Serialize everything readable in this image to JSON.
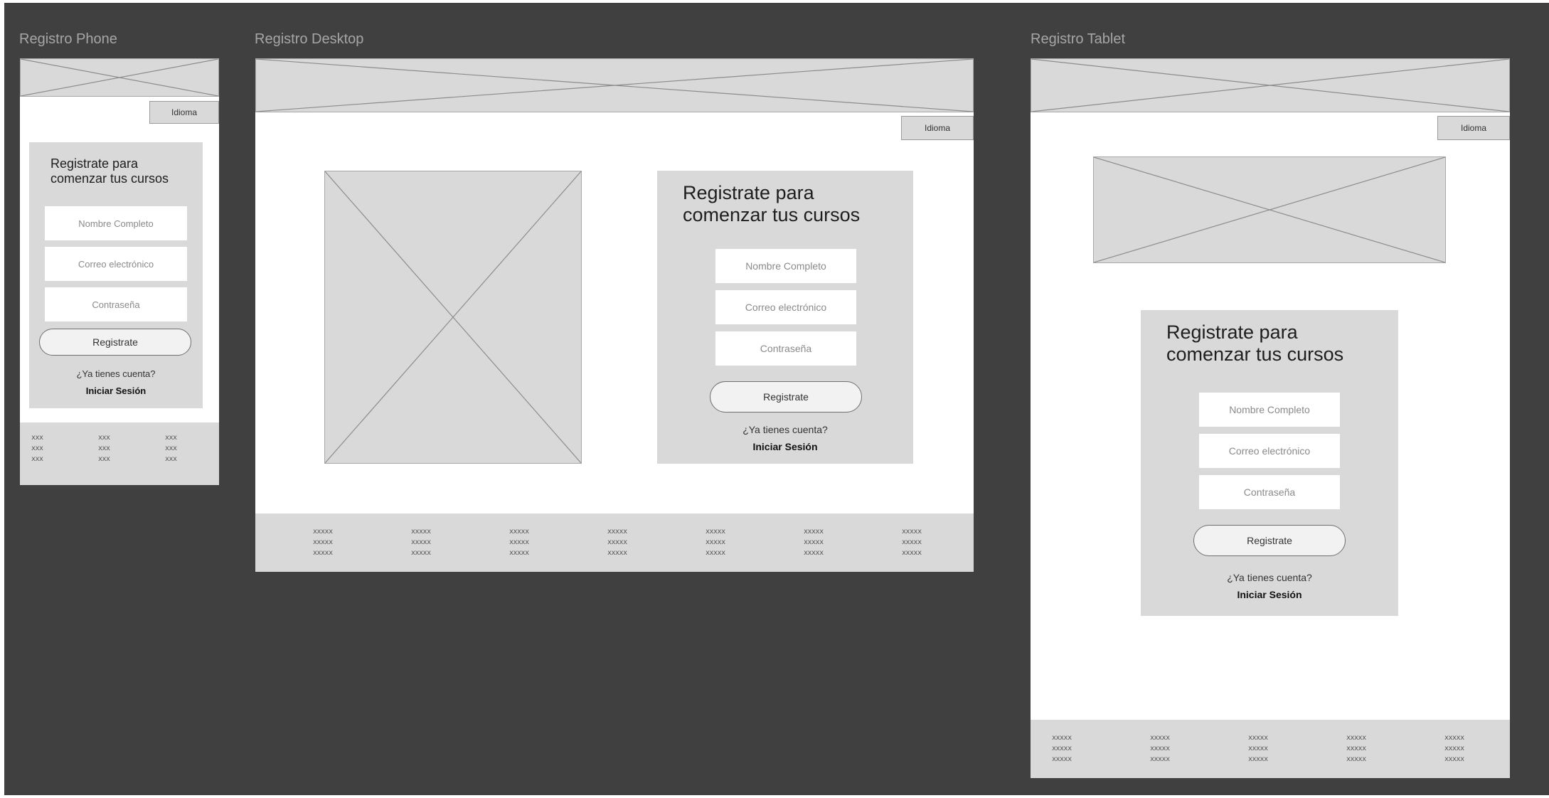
{
  "frames": {
    "phone": {
      "title": "Registro Phone",
      "language_label": "Idioma",
      "card_title": "Registrate para comenzar tus cursos",
      "fields": [
        "Nombre Completo",
        "Correo electrónico",
        "Contraseña"
      ],
      "submit_label": "Registrate",
      "have_account": "¿Ya tienes cuenta?",
      "login_label": "Iniciar Sesión",
      "footer_columns": [
        [
          "xxx",
          "xxx",
          "xxx"
        ],
        [
          "xxx",
          "xxx",
          "xxx"
        ],
        [
          "xxx",
          "xxx",
          "xxx"
        ]
      ]
    },
    "desktop": {
      "title": "Registro Desktop",
      "language_label": "Idioma",
      "card_title": "Registrate para comenzar tus cursos",
      "fields": [
        "Nombre Completo",
        "Correo electrónico",
        "Contraseña"
      ],
      "submit_label": "Registrate",
      "have_account": "¿Ya tienes cuenta?",
      "login_label": "Iniciar Sesión",
      "footer_columns": [
        [
          "xxxxx",
          "xxxxx",
          "xxxxx"
        ],
        [
          "xxxxx",
          "xxxxx",
          "xxxxx"
        ],
        [
          "xxxxx",
          "xxxxx",
          "xxxxx"
        ],
        [
          "xxxxx",
          "xxxxx",
          "xxxxx"
        ],
        [
          "xxxxx",
          "xxxxx",
          "xxxxx"
        ],
        [
          "xxxxx",
          "xxxxx",
          "xxxxx"
        ],
        [
          "xxxxx",
          "xxxxx",
          "xxxxx"
        ]
      ]
    },
    "tablet": {
      "title": "Registro Tablet",
      "language_label": "Idioma",
      "card_title": "Registrate para comenzar tus cursos",
      "fields": [
        "Nombre Completo",
        "Correo electrónico",
        "Contraseña"
      ],
      "submit_label": "Registrate",
      "have_account": "¿Ya tienes cuenta?",
      "login_label": "Iniciar Sesión",
      "footer_columns": [
        [
          "xxxxx",
          "xxxxx",
          "xxxxx"
        ],
        [
          "xxxxx",
          "xxxxx",
          "xxxxx"
        ],
        [
          "xxxxx",
          "xxxxx",
          "xxxxx"
        ],
        [
          "xxxxx",
          "xxxxx",
          "xxxxx"
        ],
        [
          "xxxxx",
          "xxxxx",
          "xxxxx"
        ]
      ]
    }
  },
  "colors": {
    "canvas": "#404040",
    "placeholder": "#d9d9d9",
    "frame_title": "#a6a6a6"
  }
}
